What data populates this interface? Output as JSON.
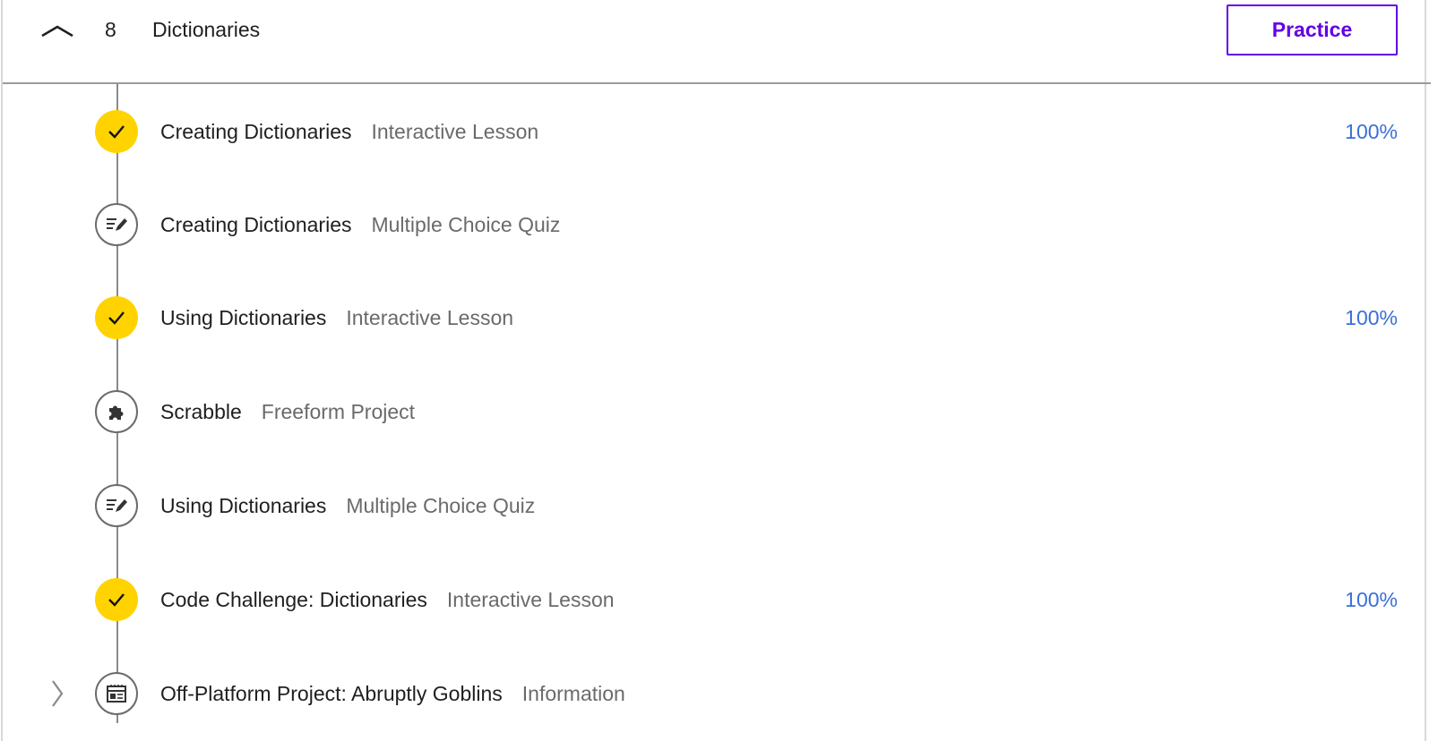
{
  "module": {
    "number": "8",
    "title": "Dictionaries",
    "practice_label": "Practice",
    "collapse_icon": "chevron-up-icon"
  },
  "items": [
    {
      "title": "Creating Dictionaries",
      "type": "Interactive Lesson",
      "progress": "100%",
      "status": "complete",
      "icon": "checkmark-icon"
    },
    {
      "title": "Creating Dictionaries",
      "type": "Multiple Choice Quiz",
      "progress": "",
      "status": "incomplete",
      "icon": "quiz-pencil-icon"
    },
    {
      "title": "Using Dictionaries",
      "type": "Interactive Lesson",
      "progress": "100%",
      "status": "complete",
      "icon": "checkmark-icon"
    },
    {
      "title": "Scrabble",
      "type": "Freeform Project",
      "progress": "",
      "status": "incomplete",
      "icon": "puzzle-piece-icon"
    },
    {
      "title": "Using Dictionaries",
      "type": "Multiple Choice Quiz",
      "progress": "",
      "status": "incomplete",
      "icon": "quiz-pencil-icon"
    },
    {
      "title": "Code Challenge: Dictionaries",
      "type": "Interactive Lesson",
      "progress": "100%",
      "status": "complete",
      "icon": "checkmark-icon"
    },
    {
      "title": "Off-Platform Project: Abruptly Goblins",
      "type": "Information",
      "progress": "",
      "status": "incomplete",
      "icon": "article-icon",
      "expandable": true
    }
  ],
  "colors": {
    "accent": "#6400e4",
    "complete": "#ffd300",
    "progress_text": "#3a6fd8"
  }
}
